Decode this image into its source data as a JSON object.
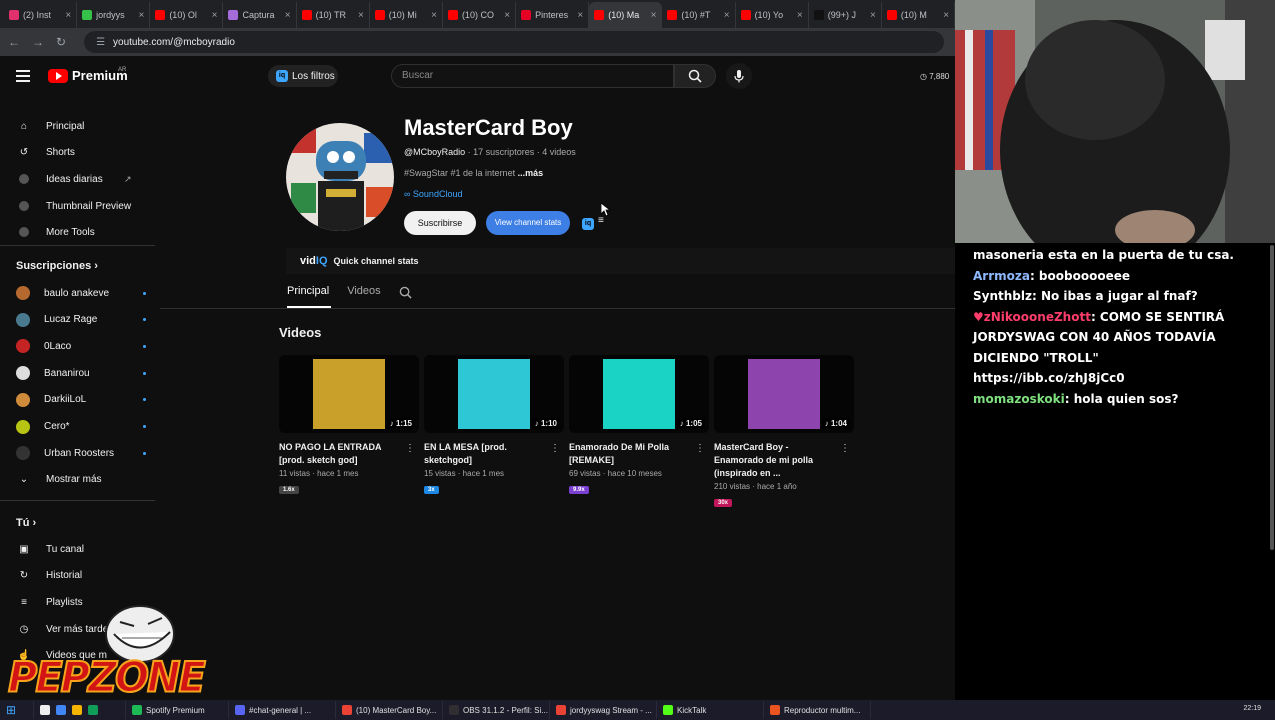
{
  "browser": {
    "tabs": [
      {
        "label": "(2) Inst",
        "color": "#e1306c"
      },
      {
        "label": "jordyys",
        "color": "#36c24a"
      },
      {
        "label": "(10) Ol",
        "color": "#ff0000"
      },
      {
        "label": "Captura",
        "color": "#a46bd9"
      },
      {
        "label": "(10) TR",
        "color": "#ff0000"
      },
      {
        "label": "(10) Mi",
        "color": "#ff0000"
      },
      {
        "label": "(10) CO",
        "color": "#ff0000"
      },
      {
        "label": "Pinteres",
        "color": "#e60023"
      },
      {
        "label": "(10) Ma",
        "color": "#ff0000",
        "active": true
      },
      {
        "label": "(10) #T",
        "color": "#ff0000"
      },
      {
        "label": "(10) Yo",
        "color": "#ff0000"
      },
      {
        "label": "(99+) J",
        "color": "#111111"
      },
      {
        "label": "(10) M",
        "color": "#ff0000"
      }
    ],
    "url": "youtube.com/@mcboyradio"
  },
  "header": {
    "brand": "Premium",
    "country": "AR",
    "filters_label": "Los filtros",
    "search_placeholder": "Buscar",
    "right_counter": "7,880"
  },
  "sidebar": {
    "main": [
      {
        "label": "Principal",
        "icon": "home-icon"
      },
      {
        "label": "Shorts",
        "icon": "shorts-icon"
      },
      {
        "label": "Ideas diarias",
        "icon": "vidiq-icon"
      },
      {
        "label": "Thumbnail Preview",
        "icon": "vidiq-icon"
      },
      {
        "label": "More Tools",
        "icon": "vidiq-icon"
      }
    ],
    "subscriptions_title": "Suscripciones",
    "subscriptions": [
      {
        "label": "baulo anakeve",
        "color": "#b5692f"
      },
      {
        "label": "Lucaz Rage",
        "color": "#4a7a90"
      },
      {
        "label": "0Laco",
        "color": "#c42424"
      },
      {
        "label": "Bananirou",
        "color": "#dddddd"
      },
      {
        "label": "DarkiiLoL",
        "color": "#cf8a3a"
      },
      {
        "label": "Cero*",
        "color": "#b8c413"
      },
      {
        "label": "Urban Roosters",
        "color": "#333333"
      }
    ],
    "show_more": "Mostrar más",
    "you_title": "Tú",
    "you": [
      {
        "label": "Tu canal",
        "icon": "channel-icon"
      },
      {
        "label": "Historial",
        "icon": "history-icon"
      },
      {
        "label": "Playlists",
        "icon": "playlists-icon"
      },
      {
        "label": "Ver más tarde",
        "icon": "watch-later-icon"
      },
      {
        "label": "Videos que m",
        "icon": "like-icon"
      }
    ]
  },
  "channel": {
    "name": "MasterCard Boy",
    "handle": "@MCboyRadio",
    "stats": " · 17 suscriptores · 4 videos",
    "description": "#SwagStar #1 de la internet",
    "more": " ...más",
    "link": "SoundCloud",
    "subscribe": "Suscribirse",
    "stats_button": "View channel stats",
    "vidiq_label": "Quick channel stats",
    "tabs": [
      "Principal",
      "Videos"
    ],
    "section_title": "Videos"
  },
  "videos": [
    {
      "title": "NO PAGO LA ENTRADA [prod. sketch god]",
      "meta": "11 vistas · hace 1 mes",
      "duration": "1:15",
      "badge": "1.6x",
      "badge_color": "#444444",
      "art": "#c9a02a"
    },
    {
      "title": "EN LA MESA [prod. sketchgod]",
      "meta": "15 vistas · hace 1 mes",
      "duration": "1:10",
      "badge": "3x",
      "badge_color": "#1e88e5",
      "art": "#2ec7d6"
    },
    {
      "title": "Enamorado De Mi Polla [REMAKE]",
      "meta": "69 vistas · hace 10 meses",
      "duration": "1:05",
      "badge": "9.9x",
      "badge_color": "#7b3fd1",
      "art": "#1bd3c4"
    },
    {
      "title": "MasterCard Boy - Enamorado de mi polla (inspirado en ...",
      "meta": "210 vistas · hace 1 año",
      "duration": "1:04",
      "badge": "30x",
      "badge_color": "#c2185b",
      "art": "#8e44ad"
    }
  ],
  "chat": [
    {
      "user": "",
      "text": "masoneria esta en la puerta de tu csa.",
      "color": "#ffffff"
    },
    {
      "user": "Arrmoza",
      "text": ": boobooooeee",
      "color": "#8fb8ff"
    },
    {
      "user": "Synthblz",
      "text": ": No ibas a jugar al fnaf?",
      "color": "#ffffff"
    },
    {
      "user": "♥zNikoooneZhott",
      "text": ": COMO SE SENTIRÁ JORDYSWAG CON 40 AÑOS TODAVÍA DICIENDO \"TROLL\"",
      "color": "#ff3d6b"
    },
    {
      "user": "",
      "text": "https://ibb.co/zhJ8jCc0",
      "color": "#ffffff"
    },
    {
      "user": "momazoskoki",
      "text": ": hola quien sos?",
      "color": "#7fe07f"
    }
  ],
  "overlay": {
    "logo_text": "PEPZONE"
  },
  "taskbar": {
    "items": [
      {
        "label": "Spotify Premium",
        "color": "#1db954"
      },
      {
        "label": "#chat-general | ...",
        "color": "#5865f2"
      },
      {
        "label": "(10) MasterCard Boy...",
        "color": "#ea4335"
      },
      {
        "label": "OBS 31.1.2 - Perfil: Si...",
        "color": "#302e31"
      },
      {
        "label": "jordyyswag Stream - ...",
        "color": "#ea4335"
      },
      {
        "label": "KickTalk",
        "color": "#53fc18"
      },
      {
        "label": "Reproductor multim...",
        "color": "#e95420"
      }
    ],
    "clock": "22:19"
  }
}
